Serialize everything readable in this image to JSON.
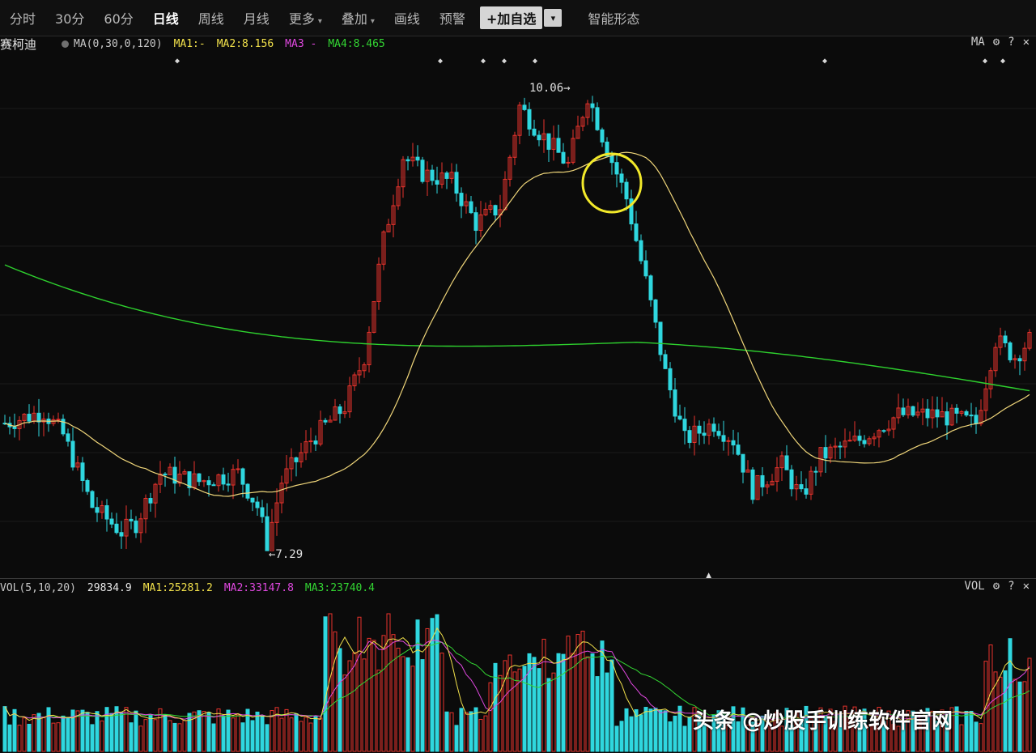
{
  "toolbar": {
    "items": [
      {
        "label": "分时",
        "active": false
      },
      {
        "label": "30分",
        "active": false
      },
      {
        "label": "60分",
        "active": false
      },
      {
        "label": "日线",
        "active": true
      },
      {
        "label": "周线",
        "active": false
      },
      {
        "label": "月线",
        "active": false
      },
      {
        "label": "更多",
        "active": false,
        "caret": true
      },
      {
        "label": "叠加",
        "active": false,
        "caret": true
      },
      {
        "label": "画线",
        "active": false
      },
      {
        "label": "预警",
        "active": false
      }
    ],
    "add_label": "+加自选",
    "dropdown_icon": "chevron-down-icon",
    "pattern_label": "智能形态"
  },
  "price_panel": {
    "stock_name": "赛柯迪",
    "ma_params": "MA(0,30,0,120)",
    "legend": [
      {
        "label": "MA1:-",
        "color": "#f2e14b"
      },
      {
        "label": "MA2:8.156",
        "color": "#f2e14b"
      },
      {
        "label": "MA3 -",
        "color": "#e048e0"
      },
      {
        "label": "MA4:8.465",
        "color": "#33d633"
      }
    ],
    "indicator": "MA",
    "high_label": "10.06",
    "low_label": "7.29",
    "colors": {
      "up": "#e8332c",
      "down": "#2fd7df",
      "ma_slow": "#f0d67a",
      "ma_long": "#2ed12e",
      "highlight": "#f2e92a"
    }
  },
  "volume_panel": {
    "params": "VOL(5,10,20)",
    "value": "29834.9",
    "legend": [
      {
        "label": "MA1:25281.2",
        "color": "#f2e14b"
      },
      {
        "label": "MA2:33147.8",
        "color": "#e048e0"
      },
      {
        "label": "MA3:23740.4",
        "color": "#33d633"
      }
    ],
    "indicator": "VOL"
  },
  "watermark": "头条 @炒股手训练软件官网",
  "icons": {
    "settings": "gear-icon",
    "help": "help-icon",
    "close": "close-icon"
  }
}
